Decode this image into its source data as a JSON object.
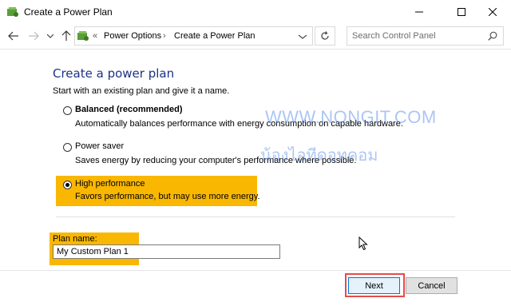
{
  "window": {
    "title": "Create a Power Plan"
  },
  "nav": {
    "breadcrumb": [
      "Power Options",
      "Create a Power Plan"
    ],
    "crumb_separator": "›",
    "overflow_chevron": "«",
    "search_placeholder": "Search Control Panel"
  },
  "content": {
    "heading": "Create a power plan",
    "intro": "Start with an existing plan and give it a name.",
    "plans": [
      {
        "name": "Balanced (recommended)",
        "description": "Automatically balances performance with energy consumption on capable hardware.",
        "selected": false
      },
      {
        "name": "Power saver",
        "description": "Saves energy by reducing your computer's performance where possible.",
        "selected": false
      },
      {
        "name": "High performance",
        "description": "Favors performance, but may use more energy.",
        "selected": true
      }
    ],
    "plan_name_label": "Plan name:",
    "plan_name_value": "My Custom Plan 1"
  },
  "watermark": {
    "line1": "WWW.NONGIT.COM",
    "line2": "น้องไอทีดอทคอม"
  },
  "buttons": {
    "next": "Next",
    "cancel": "Cancel"
  },
  "colors": {
    "heading": "#1e3287",
    "highlight": "#f9b701",
    "next_outline": "#e84a4a",
    "watermark": "#4a82e6"
  }
}
